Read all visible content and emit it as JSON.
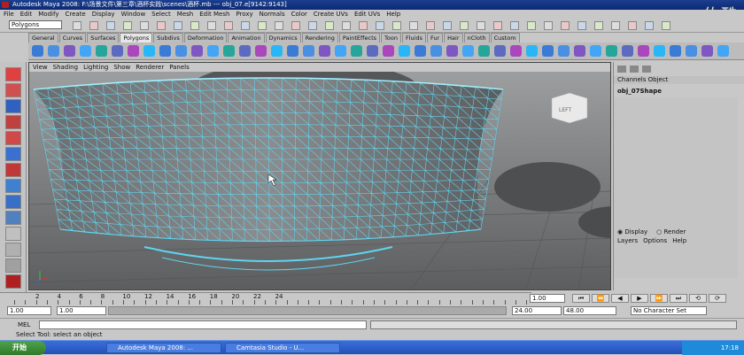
{
  "title": "Autodesk Maya 2008: F:\\场景文件\\第三章\\酒杯实践\\scenes\\酒杯.mb  ---  obj_07.e[9142:9143]",
  "watermark": "佑酷",
  "menus": [
    "File",
    "Edit",
    "Modify",
    "Create",
    "Display",
    "Window",
    "Select",
    "Mesh",
    "Edit Mesh",
    "Proxy",
    "Normals",
    "Color",
    "Create UVs",
    "Edit UVs",
    "Help"
  ],
  "mode_selector": "Polygons",
  "shelf_tabs": [
    "General",
    "Curves",
    "Surfaces",
    "Polygons",
    "Subdivs",
    "Deformation",
    "Animation",
    "Dynamics",
    "Rendering",
    "PaintEffects",
    "Toon",
    "Fluids",
    "Fur",
    "Hair",
    "nCloth",
    "Custom"
  ],
  "active_shelf": "Polygons",
  "viewport_menu": [
    "View",
    "Shading",
    "Lighting",
    "Show",
    "Renderer",
    "Panels"
  ],
  "view_cube_label": "LEFT",
  "channel_box": {
    "tabs": "Channels  Object",
    "object": "obj_07Shape"
  },
  "layer_editor": {
    "display": "Display",
    "render": "Render",
    "menu": [
      "Layers",
      "Options",
      "Help"
    ]
  },
  "timeline_ticks": [
    "2",
    "4",
    "6",
    "8",
    "10",
    "12",
    "14",
    "16",
    "18",
    "20",
    "22",
    "24"
  ],
  "current_frame": "1.00",
  "range": {
    "start": "1.00",
    "start_inner": "1.00",
    "end_inner": "24.00",
    "end": "48.00",
    "char_set": "No Character Set"
  },
  "mel_label": "MEL",
  "help_text": "Select Tool: select an object",
  "taskbar": {
    "start": "开始",
    "tasks": [
      "Autodesk Maya 2008: ...",
      "Camtasia Studio - U..."
    ],
    "clock": "17:18"
  },
  "colors": {
    "wire": "#5fd4f0",
    "bg": "#7a7c7e",
    "ui": "#c8c8c8"
  }
}
